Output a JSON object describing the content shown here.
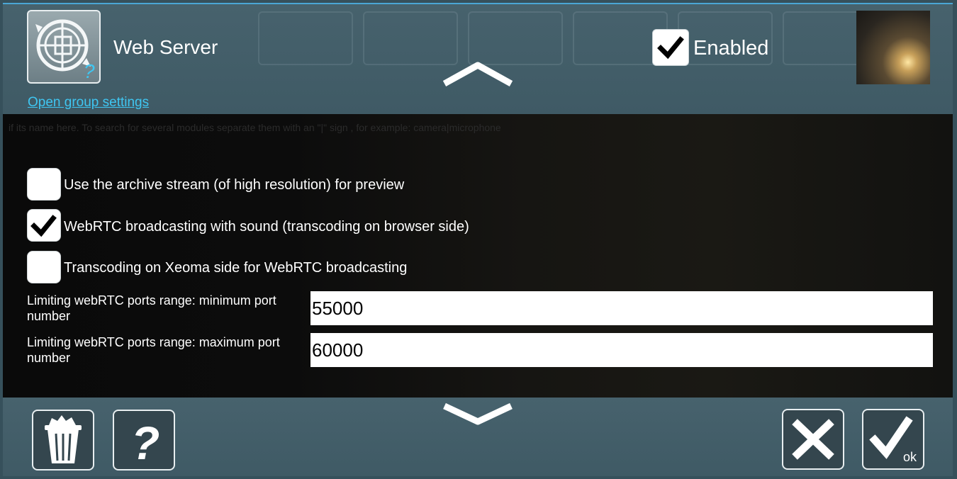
{
  "header": {
    "module_title": "Web Server",
    "group_settings_link": "Open group settings",
    "enabled_label": "Enabled",
    "enabled_checked": true
  },
  "hint": "if its name here. To search for several modules separate them with an \"|\" sign , for example: camera|microphone",
  "options": [
    {
      "label": "Use the archive stream (of high resolution) for preview",
      "checked": false
    },
    {
      "label": "WebRTC broadcasting with sound (transcoding on browser side)",
      "checked": true
    },
    {
      "label": "Transcoding on Xeoma side for WebRTC broadcasting",
      "checked": false
    }
  ],
  "fields": [
    {
      "label": "Limiting webRTC ports range: minimum port number",
      "value": "55000"
    },
    {
      "label": "Limiting webRTC ports range: maximum port number",
      "value": "60000"
    }
  ],
  "footer": {
    "help_glyph": "?",
    "ok_label": "ok"
  },
  "icons": [
    "module-webserver-icon",
    "chevron-up-icon",
    "chevron-down-icon",
    "trash-icon",
    "help-icon",
    "close-icon",
    "ok-check-icon",
    "checkmark-icon"
  ]
}
